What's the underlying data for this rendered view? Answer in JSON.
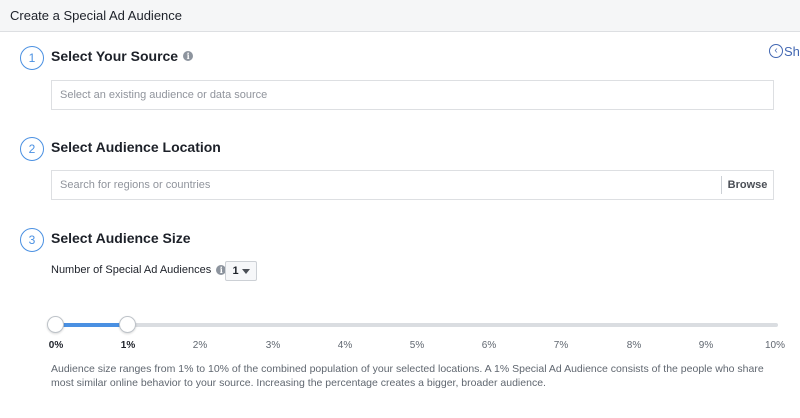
{
  "header": {
    "title": "Create a Special Ad Audience"
  },
  "show_link": {
    "label": "Sh"
  },
  "steps": [
    {
      "number": "1",
      "title": "Select Your Source"
    },
    {
      "number": "2",
      "title": "Select Audience Location"
    },
    {
      "number": "3",
      "title": "Select Audience Size"
    }
  ],
  "source": {
    "placeholder": "Select an existing audience or data source"
  },
  "location": {
    "placeholder": "Search for regions or countries",
    "browse_label": "Browse"
  },
  "size": {
    "count_label": "Number of Special Ad Audiences",
    "count_value": "1",
    "ticks": [
      "0%",
      "1%",
      "2%",
      "3%",
      "4%",
      "5%",
      "6%",
      "7%",
      "8%",
      "9%",
      "10%"
    ],
    "range_start_percent": 0,
    "range_end_percent": 1,
    "help_text": "Audience size ranges from 1% to 10% of the combined population of your selected locations. A 1% Special Ad Audience consists of the people who share most similar online behavior to your source. Increasing the percentage creates a bigger, broader audience."
  },
  "colors": {
    "accent": "#4a90e2",
    "link": "#4267b2"
  },
  "icons": {
    "info": "info-icon",
    "show": "chevron-left-circle-icon",
    "dropdown": "caret-down-icon"
  }
}
